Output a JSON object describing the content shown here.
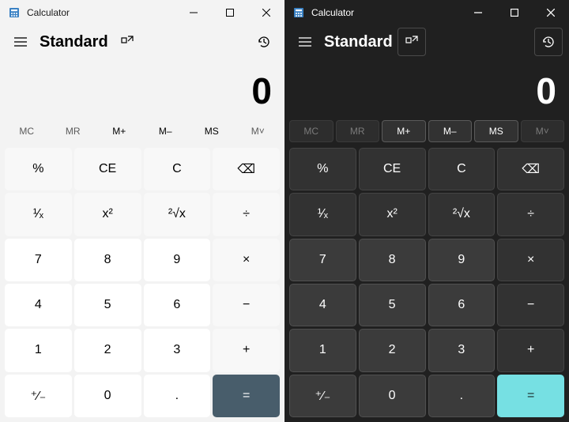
{
  "windows": [
    {
      "theme": "light"
    },
    {
      "theme": "dark"
    }
  ],
  "app": {
    "title": "Calculator",
    "mode": "Standard",
    "display_value": "0"
  },
  "memory": {
    "mc": {
      "label": "MC",
      "enabled": false
    },
    "mr": {
      "label": "MR",
      "enabled": false
    },
    "madd": {
      "label": "M+",
      "enabled": true
    },
    "msub": {
      "label": "M–",
      "enabled": true
    },
    "ms": {
      "label": "MS",
      "enabled": true
    },
    "mv": {
      "label": "M˅",
      "enabled": false
    }
  },
  "keys": {
    "percent": "%",
    "ce": "CE",
    "c": "C",
    "back": "⌫",
    "inv": "¹∕ₓ",
    "sq": "x²",
    "sqrt": "²√x",
    "div": "÷",
    "n7": "7",
    "n8": "8",
    "n9": "9",
    "mul": "×",
    "n4": "4",
    "n5": "5",
    "n6": "6",
    "sub": "−",
    "n1": "1",
    "n2": "2",
    "n3": "3",
    "add": "+",
    "neg": "⁺∕₋",
    "n0": "0",
    "dot": ".",
    "eq": "="
  },
  "icons": {
    "menu": "menu-icon",
    "keep": "keep-on-top-icon",
    "history": "history-icon",
    "min": "minimize-icon",
    "max": "maximize-icon",
    "close": "close-icon",
    "app": "calculator-app-icon"
  },
  "colors": {
    "light_equals": "#485d6b",
    "dark_equals": "#76e0e3"
  }
}
